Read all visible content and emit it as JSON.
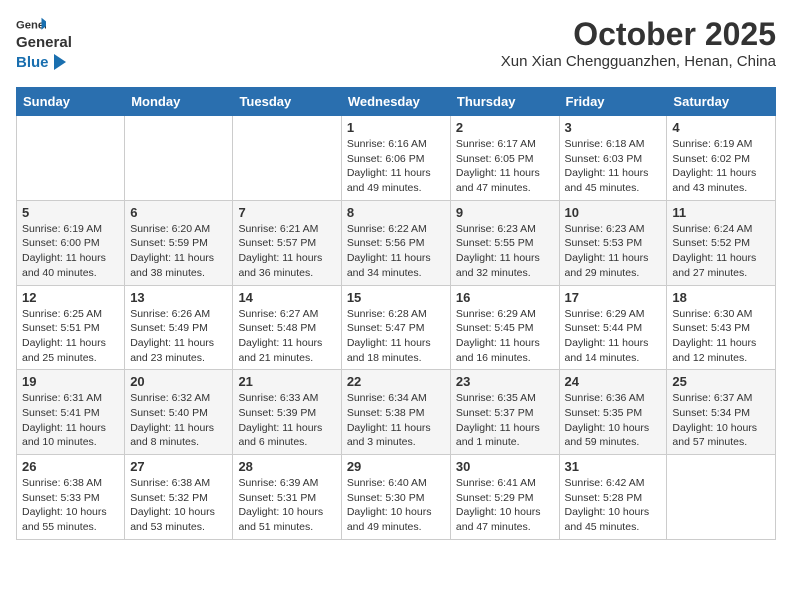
{
  "logo": {
    "general": "General",
    "blue": "Blue"
  },
  "header": {
    "month": "October 2025",
    "subtitle": "Xun Xian Chengguanzhen, Henan, China"
  },
  "weekdays": [
    "Sunday",
    "Monday",
    "Tuesday",
    "Wednesday",
    "Thursday",
    "Friday",
    "Saturday"
  ],
  "weeks": [
    [
      {
        "day": "",
        "info": ""
      },
      {
        "day": "",
        "info": ""
      },
      {
        "day": "",
        "info": ""
      },
      {
        "day": "1",
        "info": "Sunrise: 6:16 AM\nSunset: 6:06 PM\nDaylight: 11 hours and 49 minutes."
      },
      {
        "day": "2",
        "info": "Sunrise: 6:17 AM\nSunset: 6:05 PM\nDaylight: 11 hours and 47 minutes."
      },
      {
        "day": "3",
        "info": "Sunrise: 6:18 AM\nSunset: 6:03 PM\nDaylight: 11 hours and 45 minutes."
      },
      {
        "day": "4",
        "info": "Sunrise: 6:19 AM\nSunset: 6:02 PM\nDaylight: 11 hours and 43 minutes."
      }
    ],
    [
      {
        "day": "5",
        "info": "Sunrise: 6:19 AM\nSunset: 6:00 PM\nDaylight: 11 hours and 40 minutes."
      },
      {
        "day": "6",
        "info": "Sunrise: 6:20 AM\nSunset: 5:59 PM\nDaylight: 11 hours and 38 minutes."
      },
      {
        "day": "7",
        "info": "Sunrise: 6:21 AM\nSunset: 5:57 PM\nDaylight: 11 hours and 36 minutes."
      },
      {
        "day": "8",
        "info": "Sunrise: 6:22 AM\nSunset: 5:56 PM\nDaylight: 11 hours and 34 minutes."
      },
      {
        "day": "9",
        "info": "Sunrise: 6:23 AM\nSunset: 5:55 PM\nDaylight: 11 hours and 32 minutes."
      },
      {
        "day": "10",
        "info": "Sunrise: 6:23 AM\nSunset: 5:53 PM\nDaylight: 11 hours and 29 minutes."
      },
      {
        "day": "11",
        "info": "Sunrise: 6:24 AM\nSunset: 5:52 PM\nDaylight: 11 hours and 27 minutes."
      }
    ],
    [
      {
        "day": "12",
        "info": "Sunrise: 6:25 AM\nSunset: 5:51 PM\nDaylight: 11 hours and 25 minutes."
      },
      {
        "day": "13",
        "info": "Sunrise: 6:26 AM\nSunset: 5:49 PM\nDaylight: 11 hours and 23 minutes."
      },
      {
        "day": "14",
        "info": "Sunrise: 6:27 AM\nSunset: 5:48 PM\nDaylight: 11 hours and 21 minutes."
      },
      {
        "day": "15",
        "info": "Sunrise: 6:28 AM\nSunset: 5:47 PM\nDaylight: 11 hours and 18 minutes."
      },
      {
        "day": "16",
        "info": "Sunrise: 6:29 AM\nSunset: 5:45 PM\nDaylight: 11 hours and 16 minutes."
      },
      {
        "day": "17",
        "info": "Sunrise: 6:29 AM\nSunset: 5:44 PM\nDaylight: 11 hours and 14 minutes."
      },
      {
        "day": "18",
        "info": "Sunrise: 6:30 AM\nSunset: 5:43 PM\nDaylight: 11 hours and 12 minutes."
      }
    ],
    [
      {
        "day": "19",
        "info": "Sunrise: 6:31 AM\nSunset: 5:41 PM\nDaylight: 11 hours and 10 minutes."
      },
      {
        "day": "20",
        "info": "Sunrise: 6:32 AM\nSunset: 5:40 PM\nDaylight: 11 hours and 8 minutes."
      },
      {
        "day": "21",
        "info": "Sunrise: 6:33 AM\nSunset: 5:39 PM\nDaylight: 11 hours and 6 minutes."
      },
      {
        "day": "22",
        "info": "Sunrise: 6:34 AM\nSunset: 5:38 PM\nDaylight: 11 hours and 3 minutes."
      },
      {
        "day": "23",
        "info": "Sunrise: 6:35 AM\nSunset: 5:37 PM\nDaylight: 11 hours and 1 minute."
      },
      {
        "day": "24",
        "info": "Sunrise: 6:36 AM\nSunset: 5:35 PM\nDaylight: 10 hours and 59 minutes."
      },
      {
        "day": "25",
        "info": "Sunrise: 6:37 AM\nSunset: 5:34 PM\nDaylight: 10 hours and 57 minutes."
      }
    ],
    [
      {
        "day": "26",
        "info": "Sunrise: 6:38 AM\nSunset: 5:33 PM\nDaylight: 10 hours and 55 minutes."
      },
      {
        "day": "27",
        "info": "Sunrise: 6:38 AM\nSunset: 5:32 PM\nDaylight: 10 hours and 53 minutes."
      },
      {
        "day": "28",
        "info": "Sunrise: 6:39 AM\nSunset: 5:31 PM\nDaylight: 10 hours and 51 minutes."
      },
      {
        "day": "29",
        "info": "Sunrise: 6:40 AM\nSunset: 5:30 PM\nDaylight: 10 hours and 49 minutes."
      },
      {
        "day": "30",
        "info": "Sunrise: 6:41 AM\nSunset: 5:29 PM\nDaylight: 10 hours and 47 minutes."
      },
      {
        "day": "31",
        "info": "Sunrise: 6:42 AM\nSunset: 5:28 PM\nDaylight: 10 hours and 45 minutes."
      },
      {
        "day": "",
        "info": ""
      }
    ]
  ]
}
